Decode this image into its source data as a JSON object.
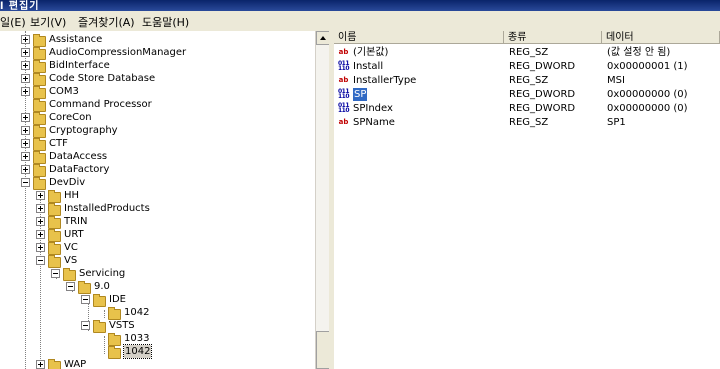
{
  "window": {
    "title_fragment": "l 편집기"
  },
  "menu": [
    "일(E)",
    "보기(V)",
    "즐겨찾기(A)",
    "도움말(H)"
  ],
  "tree": {
    "items": [
      {
        "label": "Assistance",
        "level": 0,
        "expander": "plus"
      },
      {
        "label": "AudioCompressionManager",
        "level": 0,
        "expander": "plus"
      },
      {
        "label": "BidInterface",
        "level": 0,
        "expander": "plus"
      },
      {
        "label": "Code Store Database",
        "level": 0,
        "expander": "plus"
      },
      {
        "label": "COM3",
        "level": 0,
        "expander": "plus"
      },
      {
        "label": "Command Processor",
        "level": 0,
        "expander": "none"
      },
      {
        "label": "CoreCon",
        "level": 0,
        "expander": "plus"
      },
      {
        "label": "Cryptography",
        "level": 0,
        "expander": "plus"
      },
      {
        "label": "CTF",
        "level": 0,
        "expander": "plus"
      },
      {
        "label": "DataAccess",
        "level": 0,
        "expander": "plus"
      },
      {
        "label": "DataFactory",
        "level": 0,
        "expander": "plus"
      },
      {
        "label": "DevDiv",
        "level": 0,
        "expander": "minus"
      },
      {
        "label": "HH",
        "level": 1,
        "expander": "plus"
      },
      {
        "label": "InstalledProducts",
        "level": 1,
        "expander": "plus"
      },
      {
        "label": "TRIN",
        "level": 1,
        "expander": "plus"
      },
      {
        "label": "URT",
        "level": 1,
        "expander": "plus"
      },
      {
        "label": "VC",
        "level": 1,
        "expander": "plus"
      },
      {
        "label": "VS",
        "level": 1,
        "expander": "minus"
      },
      {
        "label": "Servicing",
        "level": 2,
        "expander": "minus"
      },
      {
        "label": "9.0",
        "level": 3,
        "expander": "minus"
      },
      {
        "label": "IDE",
        "level": 4,
        "expander": "minus"
      },
      {
        "label": "1042",
        "level": 5,
        "expander": "none"
      },
      {
        "label": "VSTS",
        "level": 4,
        "expander": "minus"
      },
      {
        "label": "1033",
        "level": 5,
        "expander": "none"
      },
      {
        "label": "1042",
        "level": 5,
        "expander": "none",
        "selected": true
      },
      {
        "label": "WAP",
        "level": 1,
        "expander": "plus"
      }
    ]
  },
  "list": {
    "columns": [
      "이름",
      "종류",
      "데이터"
    ],
    "rows": [
      {
        "icon": "ab",
        "name": "(기본값)",
        "type": "REG_SZ",
        "data": "(값 설정 안 됨)"
      },
      {
        "icon": "dword",
        "name": "Install",
        "type": "REG_DWORD",
        "data": "0x00000001 (1)"
      },
      {
        "icon": "ab",
        "name": "InstallerType",
        "type": "REG_SZ",
        "data": "MSI"
      },
      {
        "icon": "dword",
        "name": "SP",
        "type": "REG_DWORD",
        "data": "0x00000000 (0)",
        "selected": true
      },
      {
        "icon": "dword",
        "name": "SPIndex",
        "type": "REG_DWORD",
        "data": "0x00000000 (0)"
      },
      {
        "icon": "ab",
        "name": "SPName",
        "type": "REG_SZ",
        "data": "SP1"
      }
    ]
  },
  "colors": {
    "selection": "#316ac5",
    "folder": "#e8c24b",
    "titlebar": "#0a246a"
  }
}
